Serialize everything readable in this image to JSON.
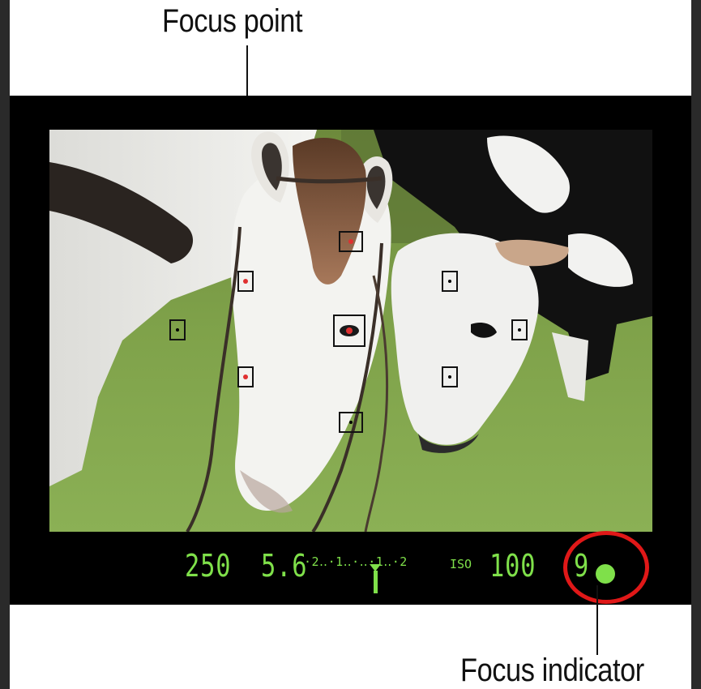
{
  "labels": {
    "focus_point": "Focus point",
    "focus_indicator": "Focus indicator"
  },
  "viewfinder": {
    "shutter_speed": "250",
    "aperture": "5.6",
    "exposure_scale": "·2‥·1‥·‥·1‥·2",
    "iso_label": "ISO",
    "iso_value": "100",
    "frames_remaining": "9"
  },
  "af_points": [
    {
      "id": "top",
      "active": true
    },
    {
      "id": "upper-left",
      "active": true
    },
    {
      "id": "far-left",
      "active": false
    },
    {
      "id": "center",
      "active": true
    },
    {
      "id": "lower-left",
      "active": true
    },
    {
      "id": "bottom",
      "active": false
    },
    {
      "id": "upper-right",
      "active": false
    },
    {
      "id": "far-right",
      "active": false
    },
    {
      "id": "lower-right",
      "active": false
    }
  ],
  "colors": {
    "lcd_green": "#7fe04a",
    "callout_red": "#e01818",
    "active_af": "#e03030"
  }
}
